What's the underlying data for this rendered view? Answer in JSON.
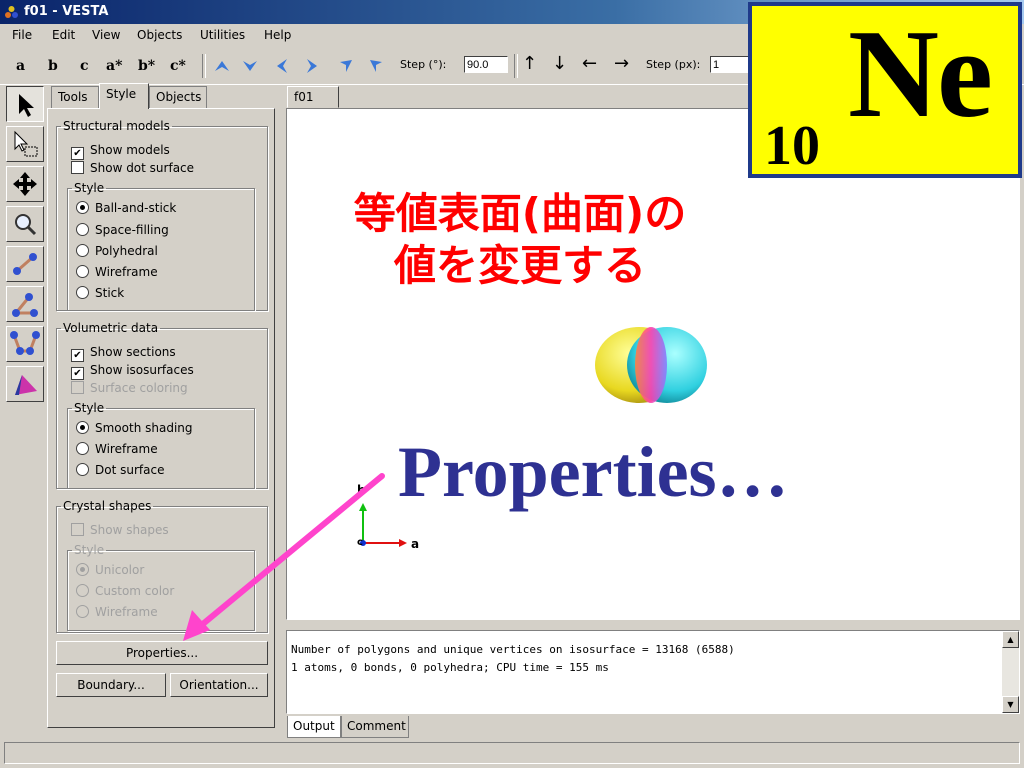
{
  "window": {
    "title": "f01 - VESTA"
  },
  "menu": [
    "File",
    "Edit",
    "View",
    "Objects",
    "Utilities",
    "Help"
  ],
  "toolbar": {
    "axes": [
      "a",
      "b",
      "c",
      "a*",
      "b*",
      "c*"
    ],
    "step_deg_label": "Step (°):",
    "step_deg_value": "90.0",
    "step_px_label": "Step (px):",
    "step_px_value": "1"
  },
  "panel": {
    "tabs": [
      "Tools",
      "Style",
      "Objects"
    ],
    "active_tab": "Style",
    "structural_models": {
      "legend": "Structural models",
      "show_models": "Show models",
      "show_models_checked": true,
      "show_dot_surface": "Show dot surface",
      "show_dot_surface_checked": false,
      "style_legend": "Style",
      "styles": [
        "Ball-and-stick",
        "Space-filling",
        "Polyhedral",
        "Wireframe",
        "Stick"
      ],
      "selected_style": "Ball-and-stick"
    },
    "volumetric_data": {
      "legend": "Volumetric data",
      "show_sections": "Show sections",
      "show_sections_checked": true,
      "show_isosurfaces": "Show isosurfaces",
      "show_isosurfaces_checked": true,
      "surface_coloring": "Surface coloring",
      "surface_coloring_enabled": false,
      "style_legend": "Style",
      "styles": [
        "Smooth shading",
        "Wireframe",
        "Dot surface"
      ],
      "selected_style": "Smooth shading"
    },
    "crystal_shapes": {
      "legend": "Crystal shapes",
      "show_shapes": "Show shapes",
      "style_legend": "Style",
      "styles": [
        "Unicolor",
        "Custom color",
        "Wireframe"
      ],
      "selected_style": "Unicolor",
      "enabled": false
    },
    "buttons": {
      "properties": "Properties...",
      "boundary": "Boundary...",
      "orientation": "Orientation..."
    }
  },
  "view": {
    "tab": "f01",
    "axis_label_a": "a",
    "axis_label_b": "b",
    "axis_label_c": "c"
  },
  "output": {
    "lines": [
      "Number of polygons and unique vertices on isosurface = 13168 (6588)",
      "1 atoms, 0 bonds, 0 polyhedra; CPU time = 155 ms"
    ],
    "tabs": [
      "Output",
      "Comment"
    ]
  },
  "overlay": {
    "element_number": "10",
    "element_symbol": "Ne",
    "note_line1": "等値表面(曲面)の",
    "note_line2": "値を変更する",
    "callout": "Properties…",
    "colors": {
      "box_fill": "#ffff00",
      "box_border": "#1f3a8a",
      "note": "#ff0000",
      "callout": "#2e3192",
      "arrow": "#ff44cc"
    }
  }
}
